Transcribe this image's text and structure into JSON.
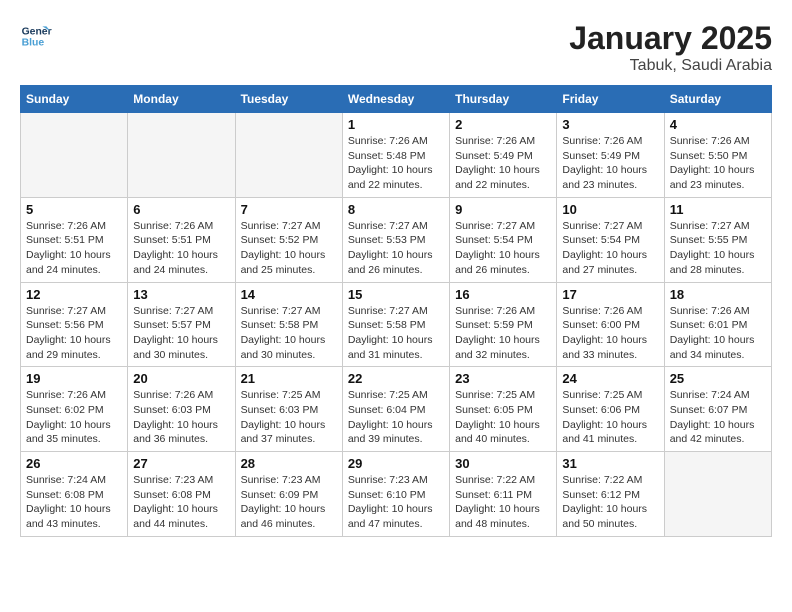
{
  "logo": {
    "line1": "General",
    "line2": "Blue"
  },
  "title": "January 2025",
  "subtitle": "Tabuk, Saudi Arabia",
  "days_of_week": [
    "Sunday",
    "Monday",
    "Tuesday",
    "Wednesday",
    "Thursday",
    "Friday",
    "Saturday"
  ],
  "weeks": [
    [
      {
        "day": "",
        "info": ""
      },
      {
        "day": "",
        "info": ""
      },
      {
        "day": "",
        "info": ""
      },
      {
        "day": "1",
        "info": "Sunrise: 7:26 AM\nSunset: 5:48 PM\nDaylight: 10 hours\nand 22 minutes."
      },
      {
        "day": "2",
        "info": "Sunrise: 7:26 AM\nSunset: 5:49 PM\nDaylight: 10 hours\nand 22 minutes."
      },
      {
        "day": "3",
        "info": "Sunrise: 7:26 AM\nSunset: 5:49 PM\nDaylight: 10 hours\nand 23 minutes."
      },
      {
        "day": "4",
        "info": "Sunrise: 7:26 AM\nSunset: 5:50 PM\nDaylight: 10 hours\nand 23 minutes."
      }
    ],
    [
      {
        "day": "5",
        "info": "Sunrise: 7:26 AM\nSunset: 5:51 PM\nDaylight: 10 hours\nand 24 minutes."
      },
      {
        "day": "6",
        "info": "Sunrise: 7:26 AM\nSunset: 5:51 PM\nDaylight: 10 hours\nand 24 minutes."
      },
      {
        "day": "7",
        "info": "Sunrise: 7:27 AM\nSunset: 5:52 PM\nDaylight: 10 hours\nand 25 minutes."
      },
      {
        "day": "8",
        "info": "Sunrise: 7:27 AM\nSunset: 5:53 PM\nDaylight: 10 hours\nand 26 minutes."
      },
      {
        "day": "9",
        "info": "Sunrise: 7:27 AM\nSunset: 5:54 PM\nDaylight: 10 hours\nand 26 minutes."
      },
      {
        "day": "10",
        "info": "Sunrise: 7:27 AM\nSunset: 5:54 PM\nDaylight: 10 hours\nand 27 minutes."
      },
      {
        "day": "11",
        "info": "Sunrise: 7:27 AM\nSunset: 5:55 PM\nDaylight: 10 hours\nand 28 minutes."
      }
    ],
    [
      {
        "day": "12",
        "info": "Sunrise: 7:27 AM\nSunset: 5:56 PM\nDaylight: 10 hours\nand 29 minutes."
      },
      {
        "day": "13",
        "info": "Sunrise: 7:27 AM\nSunset: 5:57 PM\nDaylight: 10 hours\nand 30 minutes."
      },
      {
        "day": "14",
        "info": "Sunrise: 7:27 AM\nSunset: 5:58 PM\nDaylight: 10 hours\nand 30 minutes."
      },
      {
        "day": "15",
        "info": "Sunrise: 7:27 AM\nSunset: 5:58 PM\nDaylight: 10 hours\nand 31 minutes."
      },
      {
        "day": "16",
        "info": "Sunrise: 7:26 AM\nSunset: 5:59 PM\nDaylight: 10 hours\nand 32 minutes."
      },
      {
        "day": "17",
        "info": "Sunrise: 7:26 AM\nSunset: 6:00 PM\nDaylight: 10 hours\nand 33 minutes."
      },
      {
        "day": "18",
        "info": "Sunrise: 7:26 AM\nSunset: 6:01 PM\nDaylight: 10 hours\nand 34 minutes."
      }
    ],
    [
      {
        "day": "19",
        "info": "Sunrise: 7:26 AM\nSunset: 6:02 PM\nDaylight: 10 hours\nand 35 minutes."
      },
      {
        "day": "20",
        "info": "Sunrise: 7:26 AM\nSunset: 6:03 PM\nDaylight: 10 hours\nand 36 minutes."
      },
      {
        "day": "21",
        "info": "Sunrise: 7:25 AM\nSunset: 6:03 PM\nDaylight: 10 hours\nand 37 minutes."
      },
      {
        "day": "22",
        "info": "Sunrise: 7:25 AM\nSunset: 6:04 PM\nDaylight: 10 hours\nand 39 minutes."
      },
      {
        "day": "23",
        "info": "Sunrise: 7:25 AM\nSunset: 6:05 PM\nDaylight: 10 hours\nand 40 minutes."
      },
      {
        "day": "24",
        "info": "Sunrise: 7:25 AM\nSunset: 6:06 PM\nDaylight: 10 hours\nand 41 minutes."
      },
      {
        "day": "25",
        "info": "Sunrise: 7:24 AM\nSunset: 6:07 PM\nDaylight: 10 hours\nand 42 minutes."
      }
    ],
    [
      {
        "day": "26",
        "info": "Sunrise: 7:24 AM\nSunset: 6:08 PM\nDaylight: 10 hours\nand 43 minutes."
      },
      {
        "day": "27",
        "info": "Sunrise: 7:23 AM\nSunset: 6:08 PM\nDaylight: 10 hours\nand 44 minutes."
      },
      {
        "day": "28",
        "info": "Sunrise: 7:23 AM\nSunset: 6:09 PM\nDaylight: 10 hours\nand 46 minutes."
      },
      {
        "day": "29",
        "info": "Sunrise: 7:23 AM\nSunset: 6:10 PM\nDaylight: 10 hours\nand 47 minutes."
      },
      {
        "day": "30",
        "info": "Sunrise: 7:22 AM\nSunset: 6:11 PM\nDaylight: 10 hours\nand 48 minutes."
      },
      {
        "day": "31",
        "info": "Sunrise: 7:22 AM\nSunset: 6:12 PM\nDaylight: 10 hours\nand 50 minutes."
      },
      {
        "day": "",
        "info": ""
      }
    ]
  ]
}
